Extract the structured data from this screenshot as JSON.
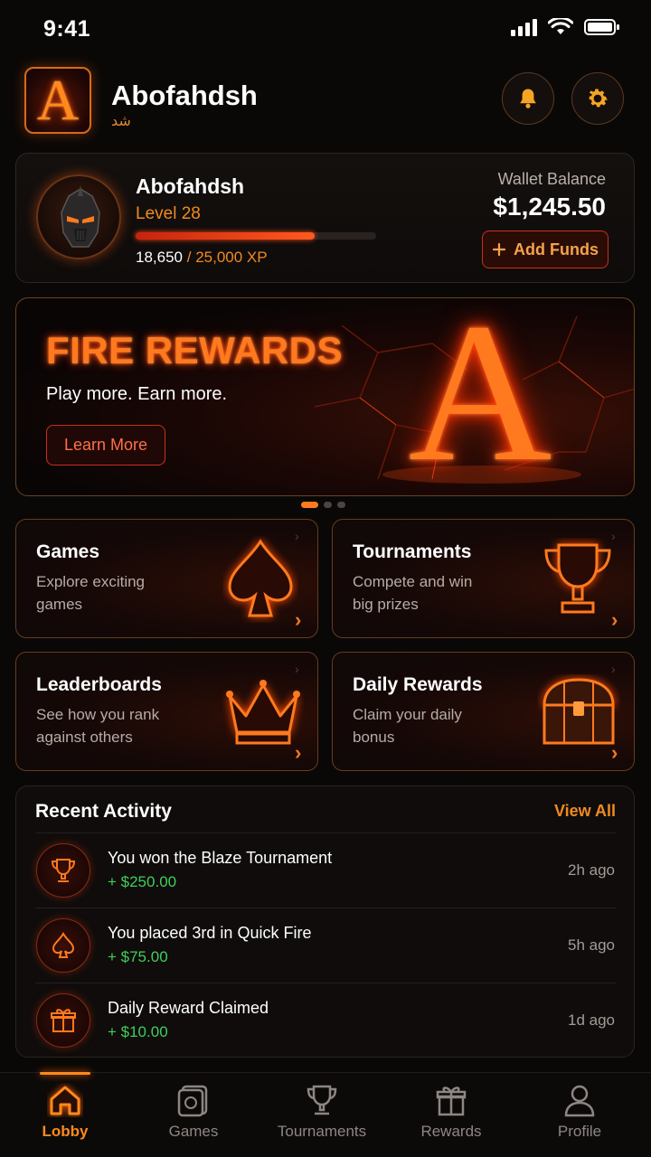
{
  "status_bar": {
    "time": "9:41"
  },
  "header": {
    "app_name": "Abofahdsh",
    "app_subtitle": "ﺷﺪ",
    "logo_letter": "A"
  },
  "profile": {
    "name": "Abofahdsh",
    "level": "Level 28",
    "xp_current": "18,650",
    "xp_separator": "/",
    "xp_max": "25,000 XP",
    "xp_progress_fraction": 0.746,
    "wallet_label": "Wallet Balance",
    "wallet_amount": "$1,245.50",
    "add_funds_label": "Add Funds"
  },
  "banner": {
    "title": "FIRE REWARDS",
    "subtitle": "Play more. Earn more.",
    "cta_label": "Learn More",
    "art_letter": "A",
    "slides": 3,
    "active_slide": 1
  },
  "tiles": [
    {
      "title": "Games",
      "description": "Explore exciting games",
      "icon": "spade-icon"
    },
    {
      "title": "Tournaments",
      "description": "Compete and win big prizes",
      "icon": "trophy-icon"
    },
    {
      "title": "Leaderboards",
      "description": "See how you rank against others",
      "icon": "crown-icon"
    },
    {
      "title": "Daily Rewards",
      "description": "Claim your daily bonus",
      "icon": "treasure-chest-icon"
    }
  ],
  "activity": {
    "title": "Recent Activity",
    "view_all_label": "View All",
    "items": [
      {
        "label": "You won the Blaze Tournament",
        "amount": "+ $250.00",
        "time": "2h ago",
        "icon": "trophy-icon"
      },
      {
        "label": "You placed 3rd in Quick Fire",
        "amount": "+ $75.00",
        "time": "5h ago",
        "icon": "spade-icon"
      },
      {
        "label": "Daily Reward Claimed",
        "amount": "+ $10.00",
        "time": "1d ago",
        "icon": "gift-icon"
      }
    ]
  },
  "bottom_nav": {
    "items": [
      {
        "label": "Lobby",
        "icon": "home-icon",
        "active": true
      },
      {
        "label": "Games",
        "icon": "game-card-icon",
        "active": false
      },
      {
        "label": "Tournaments",
        "icon": "trophy-icon",
        "active": false
      },
      {
        "label": "Rewards",
        "icon": "gift-icon",
        "active": false
      },
      {
        "label": "Profile",
        "icon": "user-icon",
        "active": false
      }
    ]
  },
  "colors": {
    "accent": "#ff8a1c",
    "fire_red": "#c9301a",
    "positive": "#3fcf5a",
    "background": "#0a0807"
  }
}
